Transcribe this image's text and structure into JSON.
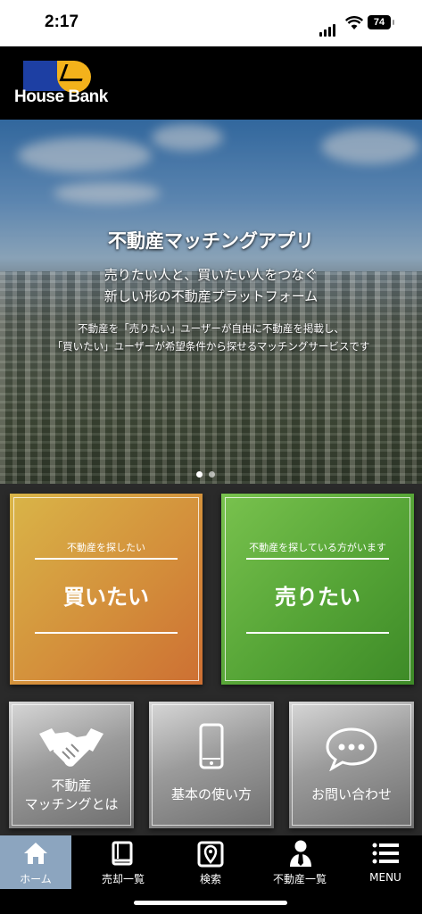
{
  "status_bar": {
    "time": "2:17",
    "battery": "74"
  },
  "header": {
    "logo_text": "House Bank"
  },
  "hero": {
    "title": "不動産マッチングアプリ",
    "subtitle_line1": "売りたい人と、買いたい人をつなぐ",
    "subtitle_line2": "新しい形の不動産プラットフォーム",
    "desc_line1": "不動産を「売りたい」ユーザーが自由に不動産を掲載し、",
    "desc_line2": "「買いたい」ユーザーが希望条件から探せるマッチングサービスです",
    "slide_count": 2,
    "active_slide": 1
  },
  "cards": {
    "buy": {
      "small": "不動産を探したい",
      "big": "買いたい",
      "color_from": "#d9b548",
      "color_to": "#cd6f33"
    },
    "sell": {
      "small": "不動産を探している方がいます",
      "big": "売りたい",
      "color_from": "#79c24e",
      "color_to": "#3d8a27"
    }
  },
  "tiles": {
    "about": {
      "line1": "不動産",
      "line2": "マッチングとは",
      "icon": "handshake-icon"
    },
    "usage": {
      "label": "基本の使い方",
      "icon": "smartphone-icon"
    },
    "contact": {
      "label": "お問い合わせ",
      "icon": "chat-bubble-icon"
    }
  },
  "nav": {
    "items": [
      {
        "label": "ホーム",
        "icon": "home-icon",
        "active": true
      },
      {
        "label": "売却一覧",
        "icon": "book-icon",
        "active": false
      },
      {
        "label": "検索",
        "icon": "map-pin-icon",
        "active": false
      },
      {
        "label": "不動産一覧",
        "icon": "agent-icon",
        "active": false
      },
      {
        "label": "MENU",
        "icon": "menu-icon",
        "active": false
      }
    ],
    "active_color": "#8ca5bf"
  }
}
